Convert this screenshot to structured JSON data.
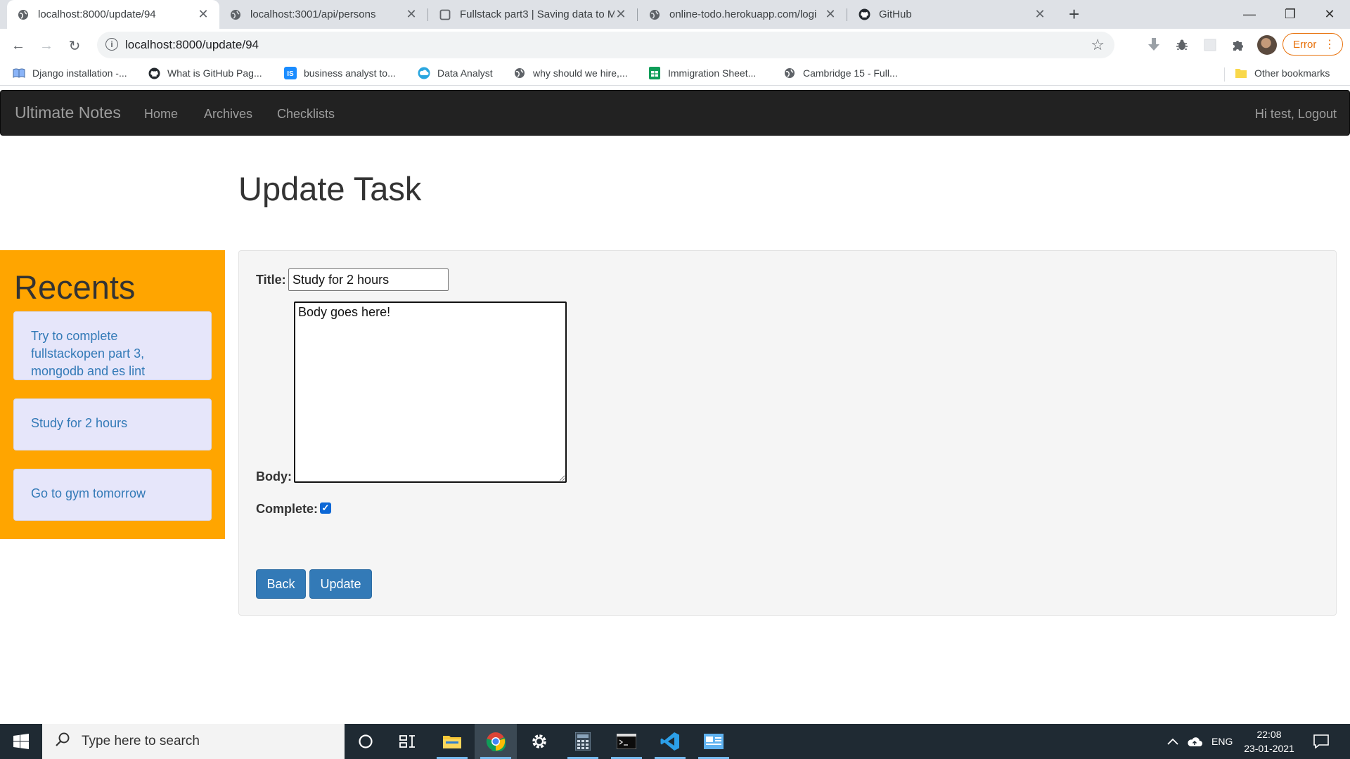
{
  "browser": {
    "tabs": [
      {
        "title": "localhost:8000/update/94",
        "favicon": "globe-icon",
        "active": true
      },
      {
        "title": "localhost:3001/api/persons",
        "favicon": "globe-icon"
      },
      {
        "title": "Fullstack part3 | Saving data to M",
        "favicon": "page-icon"
      },
      {
        "title": "online-todo.herokuapp.com/logi",
        "favicon": "globe-icon"
      },
      {
        "title": "GitHub",
        "favicon": "github-icon"
      }
    ],
    "url": "localhost:8000/update/94",
    "profile_status": "Error",
    "bookmarks": [
      {
        "label": "Django installation -...",
        "icon": "book-icon"
      },
      {
        "label": "What is GitHub Pag...",
        "icon": "github-icon"
      },
      {
        "label": "business analyst to...",
        "icon": "is-icon"
      },
      {
        "label": "Data Analyst",
        "icon": "cloud-icon"
      },
      {
        "label": "why should we hire,...",
        "icon": "globe-icon"
      },
      {
        "label": "Immigration Sheet...",
        "icon": "sheets-icon"
      },
      {
        "label": "Cambridge 15 - Full...",
        "icon": "globe-icon"
      }
    ],
    "other_bookmarks": "Other bookmarks"
  },
  "navbar": {
    "brand": "Ultimate Notes",
    "links": [
      "Home",
      "Archives",
      "Checklists"
    ],
    "user": "Hi test, Logout"
  },
  "page": {
    "heading": "Update Task"
  },
  "recents": {
    "heading": "Recents",
    "items": [
      "Try to complete fullstackopen part 3, mongodb and es lint",
      "Study for 2 hours",
      "Go to gym tomorrow"
    ]
  },
  "form": {
    "title_label": "Title:",
    "title_value": "Study for 2 hours",
    "body_label": "Body:",
    "body_value": "Body goes here!",
    "complete_label": "Complete:",
    "complete_checked": true,
    "back_label": "Back",
    "update_label": "Update"
  },
  "taskbar": {
    "search_placeholder": "Type here to search",
    "language": "ENG",
    "time": "22:08",
    "date": "23-01-2021"
  }
}
